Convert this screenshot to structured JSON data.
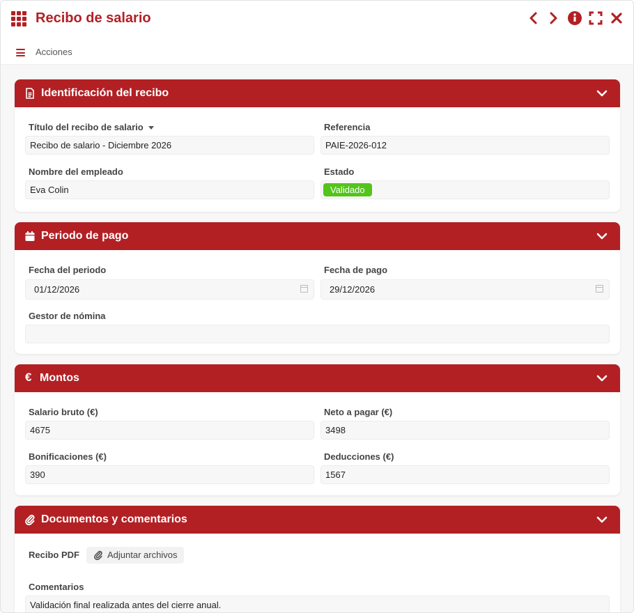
{
  "window": {
    "title": "Recibo de salario",
    "accent_color": "#b22024"
  },
  "actions": {
    "label": "Acciones"
  },
  "sections": {
    "identificacion": {
      "title": "Identificación del recibo",
      "titulo_label": "Título del recibo de salario",
      "titulo_value": "Recibo de salario - Diciembre 2026",
      "referencia_label": "Referencia",
      "referencia_value": "PAIE-2026-012",
      "empleado_label": "Nombre del empleado",
      "empleado_value": "Eva Colin",
      "estado_label": "Estado",
      "estado_value": "Validado",
      "estado_color": "#52c41a"
    },
    "periodo": {
      "title": "Periodo de pago",
      "fecha_periodo_label": "Fecha del periodo",
      "fecha_periodo_value": "01/12/2026",
      "fecha_pago_label": "Fecha de pago",
      "fecha_pago_value": "29/12/2026",
      "gestor_label": "Gestor de nómina",
      "gestor_value": ""
    },
    "montos": {
      "title": "Montos",
      "icon_text": "€",
      "bruto_label": "Salario bruto (€)",
      "bruto_value": "4675",
      "neto_label": "Neto a pagar (€)",
      "neto_value": "3498",
      "bonif_label": "Bonificaciones (€)",
      "bonif_value": "390",
      "deduc_label": "Deducciones (€)",
      "deduc_value": "1567"
    },
    "documentos": {
      "title": "Documentos y comentarios",
      "pdf_label": "Recibo PDF",
      "attach_label": "Adjuntar archivos",
      "comentarios_label": "Comentarios",
      "comentarios_value": "Validación final realizada antes del cierre anual."
    }
  }
}
